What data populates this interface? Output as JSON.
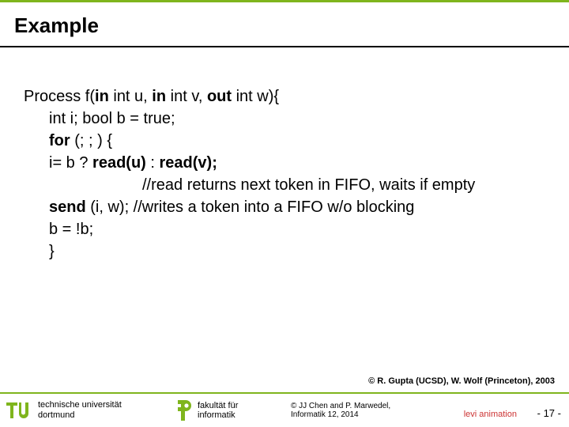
{
  "title": "Example",
  "code": {
    "l1a": "Process f(",
    "l1b": "in",
    "l1c": " int u, ",
    "l1d": "in",
    "l1e": " int v, ",
    "l1f": "out",
    "l1g": " int w){",
    "l2": "int i; bool b = true;",
    "l3a": "for ",
    "l3b": "(; ; ) {",
    "l4a": "i= b ? ",
    "l4b": "read(u) ",
    "l4c": ": ",
    "l4d": "read(v);",
    "l5": "//read returns next token in FIFO, waits if empty",
    "l6a": "send",
    "l6b": " (i, w);  //writes a token into a FIFO w/o blocking",
    "l7": "b = !b;",
    "l8": "}"
  },
  "credit": "© R. Gupta (UCSD), W. Wolf (Princeton), 2003",
  "footer": {
    "uni_l1": "technische universität",
    "uni_l2": "dortmund",
    "fak_l1": "fakultät für",
    "fak_l2": "informatik",
    "copy_l1": "© JJ Chen and  P. Marwedel,",
    "copy_l2": "Informatik 12,  2014",
    "link": "levi animation",
    "page_prefix": "-  ",
    "page_num": "17",
    "page_suffix": " -"
  },
  "icons": {
    "tu": "tu-logo",
    "fi": "fi-logo"
  }
}
